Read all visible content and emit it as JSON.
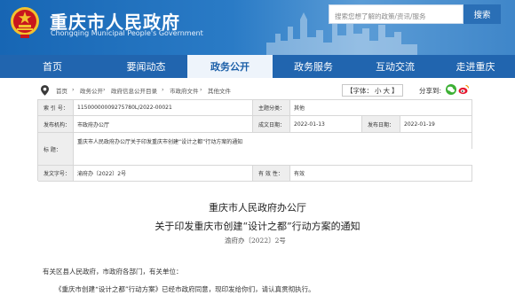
{
  "header": {
    "title": "重庆市人民政府",
    "subtitle": "Chongqing Municipal People's Government",
    "search": {
      "placeholder": "搜索您想了解的政策/资讯/服务",
      "button_label": "搜索"
    },
    "colors": {
      "brand_blue": "#1766b4",
      "nav_blue": "#2165af",
      "emblem_red": "#c8161d",
      "emblem_gold": "#f2c12e"
    }
  },
  "nav": {
    "items": [
      {
        "label": "首页"
      },
      {
        "label": "要闻动态"
      },
      {
        "label": "政务公开",
        "active": true
      },
      {
        "label": "政务服务"
      },
      {
        "label": "互动交流"
      },
      {
        "label": "走进重庆"
      }
    ]
  },
  "breadcrumb": {
    "items": [
      "首页",
      "政务公开",
      "政府信息公开目录",
      "市政府文件",
      "其他文件"
    ],
    "separator": "›",
    "icon": "location-pin-icon"
  },
  "toolbar": {
    "font_label": "【字体：",
    "font_small": "小",
    "font_large": "大",
    "font_close": "】",
    "share_label": "分享到:",
    "share_icons": [
      "wechat-icon",
      "weibo-icon"
    ]
  },
  "meta": {
    "index_label": "索 引 号：",
    "index_value": "11500000009275780L/2022-00021",
    "topic_label": "主题分类：",
    "topic_value": "其他",
    "issuer_label": "发布机构：",
    "issuer_value": "市政府办公厅",
    "written_label": "成文日期：",
    "written_value": "2022-01-13",
    "published_label": "发布日期：",
    "published_value": "2022-01-19",
    "title_label": "标 题：",
    "title_value": "重庆市人民政府办公厅关于印发重庆市创建“设计之都”行动方案的通知",
    "docno_label": "发文字号：",
    "docno_value": "渝府办〔2022〕2号",
    "validity_label": "有 效 性：",
    "validity_value": "有效"
  },
  "document": {
    "org": "重庆市人民政府办公厅",
    "title": "关于印发重庆市创建“设计之都”行动方案的通知",
    "number": "渝府办〔2022〕2号",
    "salutation": "有关区县人民政府，市政府各部门，有关单位：",
    "body": "《重庆市创建“设计之都”行动方案》已经市政府同意，现印发给你们，请认真贯彻执行。"
  }
}
